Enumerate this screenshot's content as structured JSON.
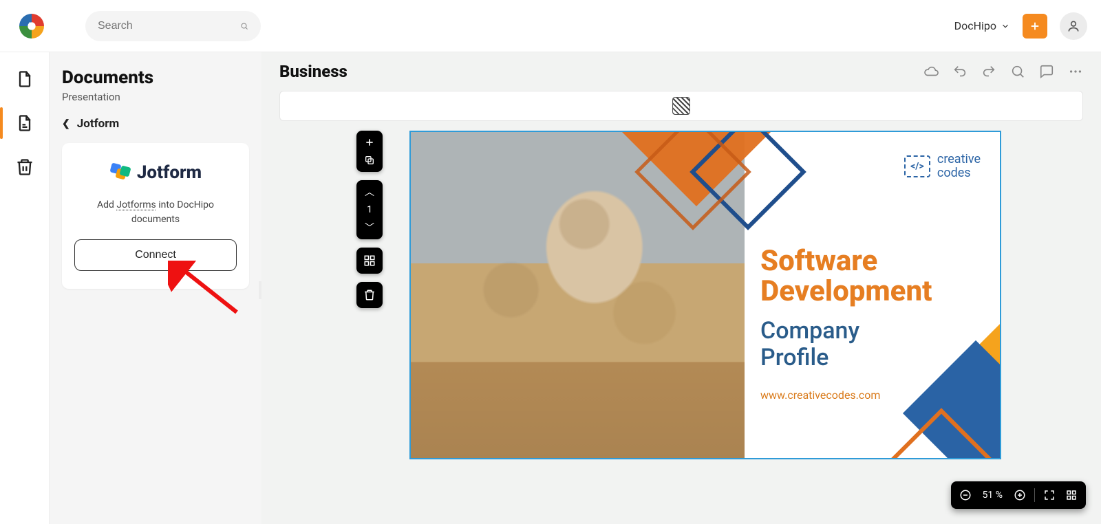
{
  "search": {
    "placeholder": "Search"
  },
  "workspace": {
    "name": "DocHipo"
  },
  "sidepanel": {
    "title": "Documents",
    "subtitle": "Presentation",
    "back_label": "Jotform",
    "card": {
      "brand": "Jotform",
      "desc_prefix": "Add ",
      "desc_link": "Jotforms",
      "desc_suffix": " into DocHipo documents",
      "connect": "Connect"
    }
  },
  "document": {
    "title": "Business"
  },
  "page": {
    "current": "1"
  },
  "slide": {
    "brand_top": "creative",
    "brand_bottom": "codes",
    "brand_mark": "</>",
    "headline_a": "Software",
    "headline_b": "Development",
    "sub_a": "Company",
    "sub_b": "Profile",
    "url": "www.creativecodes.com"
  },
  "zoom": {
    "value": "51 %"
  }
}
